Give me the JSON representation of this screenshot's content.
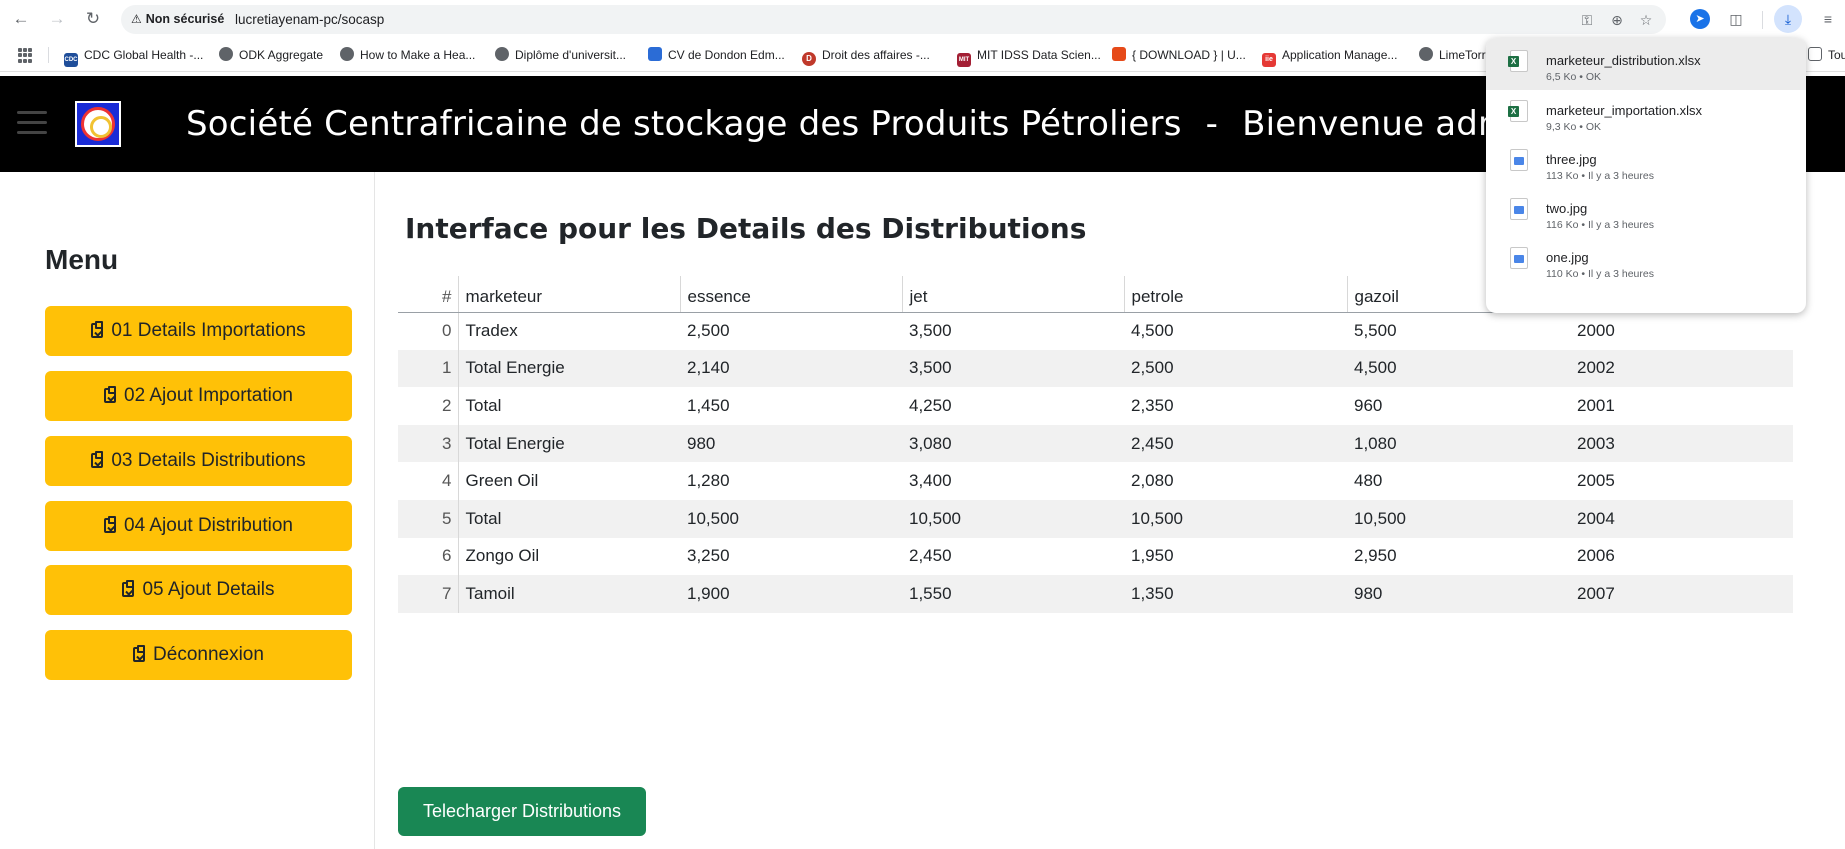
{
  "browser": {
    "security_label": "Non sécurisé",
    "url": "lucretiayenam-pc/socasp",
    "bookmarks": [
      {
        "label": "CDC Global Health -...",
        "icon": "cdc-icon",
        "color": "#1f4e9a"
      },
      {
        "label": "ODK Aggregate",
        "icon": "globe-icon",
        "color": "#5f6368"
      },
      {
        "label": "How to Make a Hea...",
        "icon": "globe-icon",
        "color": "#5f6368"
      },
      {
        "label": "Diplôme d'universit...",
        "icon": "globe-icon",
        "color": "#5f6368"
      },
      {
        "label": "CV de Dondon Edm...",
        "icon": "doc-icon",
        "color": "#2b6cd6"
      },
      {
        "label": "Droit des affaires -...",
        "icon": "d-icon",
        "color": "#c0392b"
      },
      {
        "label": "MIT IDSS Data Scien...",
        "icon": "mit-icon",
        "color": "#a31f34"
      },
      {
        "label": "{ DOWNLOAD } | U...",
        "icon": "bookmark-red-icon",
        "color": "#e64a19"
      },
      {
        "label": "Application Manage...",
        "icon": "iie-icon",
        "color": "#e53935"
      },
      {
        "label": "LimeTorr",
        "icon": "globe-icon",
        "color": "#5f6368"
      },
      {
        "label": "Tou",
        "icon": "folder-icon",
        "color": "#5f6368"
      }
    ]
  },
  "header": {
    "title": "Société Centrafricaine de stockage des Produits Pétroliers",
    "separator": "-",
    "welcome": "Bienvenue admin"
  },
  "sidebar": {
    "title": "Menu",
    "items": [
      {
        "label": "01 Details Importations"
      },
      {
        "label": "02 Ajout Importation"
      },
      {
        "label": "03 Details Distributions"
      },
      {
        "label": "04 Ajout Distribution"
      },
      {
        "label": "05 Ajout Details"
      },
      {
        "label": "Déconnexion"
      }
    ],
    "button_color": "#ffc107"
  },
  "main": {
    "title": "Interface pour les Details des Distributions",
    "table": {
      "columns": [
        "#",
        "marketeur",
        "essence",
        "jet",
        "petrole",
        "gazoil",
        ""
      ],
      "rows": [
        [
          "0",
          "Tradex",
          "2,500",
          "3,500",
          "4,500",
          "5,500",
          "2000"
        ],
        [
          "1",
          "Total Energie",
          "2,140",
          "3,500",
          "2,500",
          "4,500",
          "2002"
        ],
        [
          "2",
          "Total",
          "1,450",
          "4,250",
          "2,350",
          "960",
          "2001"
        ],
        [
          "3",
          "Total Energie",
          "980",
          "3,080",
          "2,450",
          "1,080",
          "2003"
        ],
        [
          "4",
          "Green Oil",
          "1,280",
          "3,400",
          "2,080",
          "480",
          "2005"
        ],
        [
          "5",
          "Total",
          "10,500",
          "10,500",
          "10,500",
          "10,500",
          "2004"
        ],
        [
          "6",
          "Zongo Oil",
          "3,250",
          "2,450",
          "1,950",
          "2,950",
          "2006"
        ],
        [
          "7",
          "Tamoil",
          "1,900",
          "1,550",
          "1,350",
          "980",
          "2007"
        ]
      ]
    },
    "download_button": "Telecharger Distributions",
    "download_button_color": "#198754"
  },
  "downloads": {
    "items": [
      {
        "name": "marketeur_distribution.xlsx",
        "meta": "6,5 Ko • OK",
        "type": "xlsx"
      },
      {
        "name": "marketeur_importation.xlsx",
        "meta": "9,3 Ko • OK",
        "type": "xlsx"
      },
      {
        "name": "three.jpg",
        "meta": "113 Ko • Il y a 3 heures",
        "type": "jpg"
      },
      {
        "name": "two.jpg",
        "meta": "116 Ko • Il y a 3 heures",
        "type": "jpg"
      },
      {
        "name": "one.jpg",
        "meta": "110 Ko • Il y a 3 heures",
        "type": "jpg"
      }
    ]
  }
}
